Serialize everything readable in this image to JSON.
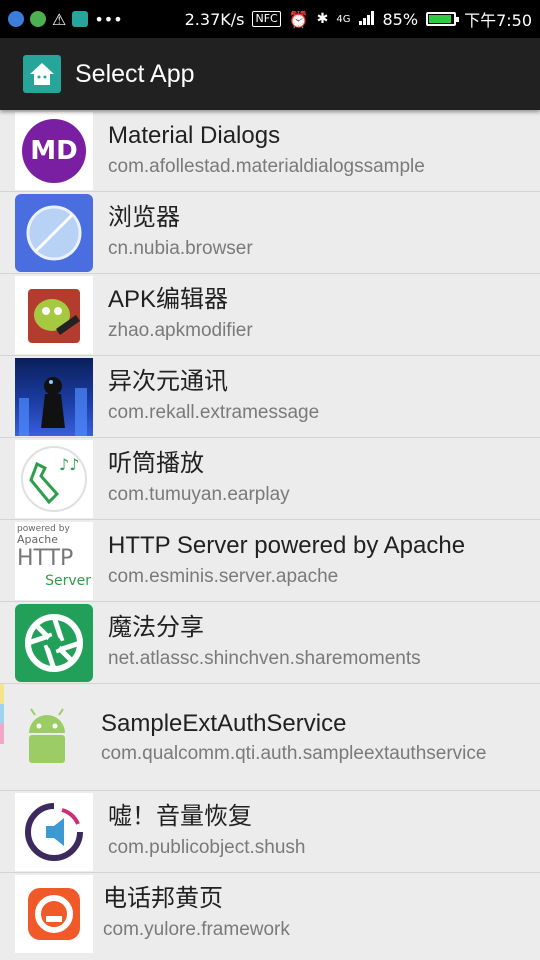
{
  "status_bar": {
    "speed": "2.37K/s",
    "nfc": "NFC",
    "signal": "4G",
    "battery_percent": "85%",
    "battery_level": 0.85,
    "time": "下午7:50"
  },
  "app_bar": {
    "title": "Select App",
    "icon": "home-icon",
    "color": "#26a69a"
  },
  "apps": [
    {
      "label": "Material Dialogs",
      "package": "com.afollestad.materialdialogssample",
      "icon_text": "MD"
    },
    {
      "label": "浏览器",
      "package": "cn.nubia.browser"
    },
    {
      "label": "APK编辑器",
      "package": "zhao.apkmodifier"
    },
    {
      "label": "异次元通讯",
      "package": "com.rekall.extramessage"
    },
    {
      "label": "听筒播放",
      "package": "com.tumuyan.earplay"
    },
    {
      "label": "HTTP Server powered by Apache",
      "package": "com.esminis.server.apache",
      "icon_lines": [
        "powered by",
        "Apache",
        "HTTP",
        "Server"
      ]
    },
    {
      "label": "魔法分享",
      "package": "net.atlassc.shinchven.sharemoments"
    },
    {
      "label": "SampleExtAuthService",
      "package": "com.qualcomm.qti.auth.sampleextauthservice"
    },
    {
      "label": "嘘！音量恢复",
      "package": "com.publicobject.shush"
    },
    {
      "label": "电话邦黄页",
      "package": "com.yulore.framework"
    }
  ]
}
